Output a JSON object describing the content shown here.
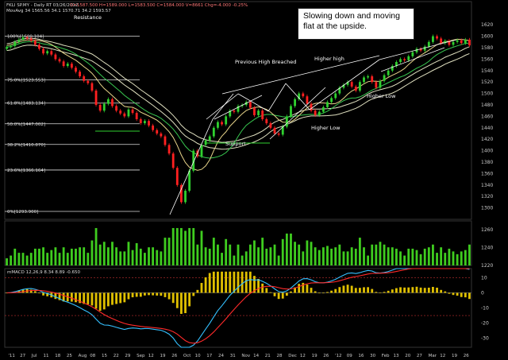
{
  "header": {
    "symbol_line": "FKLI SP.MY - Daily RT  03/26/2012",
    "ohlc_line": "O=1587.500  H=1589.000  L=1583.500  C=1584.000  V=8661  Chg=-4.000  -0.25%",
    "ma_line": "MovAvg 34  1565.56  34.1  1570.71  34.2  1593.57"
  },
  "note": "Slowing down and moving flat at the upside.",
  "annotations": {
    "resistance": "Resistance",
    "support": "Support",
    "previous_high": "Previous High Breached",
    "higher_high": "Higher high",
    "higher_low_1": "Higher Low",
    "higher_low_2": "Higher Low"
  },
  "macd_label": "mMACD 12,26,9  8.34  8.89  -0.650",
  "colors": {
    "background": "#000000",
    "up_candle": "#2fd12f",
    "down_candle": "#ff2020",
    "volume": "#3fcc1f",
    "macd_line": "#34c0ff",
    "signal_line": "#ff2a2a",
    "histogram": "#e0c000",
    "ma_fast": "#e8d48a",
    "ma_mid": "#38c850",
    "ma_slow": "#e0e0c0"
  },
  "chart_data": [
    {
      "type": "candlestick",
      "title": "FKLI SP.MY - Daily",
      "ylim": [
        1280,
        1630
      ],
      "y_ticks": [
        1300,
        1320,
        1340,
        1360,
        1380,
        1400,
        1420,
        1440,
        1460,
        1480,
        1500,
        1520,
        1540,
        1560,
        1580,
        1600,
        1620
      ],
      "fib_levels": [
        {
          "label": "100%[1600.104]",
          "value": 1600.104
        },
        {
          "label": "75.0%[1523.553]",
          "value": 1523.553
        },
        {
          "label": "61.8%[1483.134]",
          "value": 1483.134
        },
        {
          "label": "50.0%[1447.002]",
          "value": 1447.002
        },
        {
          "label": "38.2%[1410.870]",
          "value": 1410.87
        },
        {
          "label": "23.6%[1366.164]",
          "value": 1366.164
        },
        {
          "label": "0%[1293.900]",
          "value": 1293.9
        }
      ],
      "x_labels": [
        "'11",
        "27",
        "Jul",
        "11",
        "18",
        "25",
        "Aug",
        "08",
        "15",
        "22",
        "29",
        "Sep",
        "12",
        "19",
        "26",
        "Oct",
        "10",
        "17",
        "24",
        "31",
        "Nov",
        "14",
        "21",
        "28",
        "Dec",
        "12",
        "19",
        "26",
        "'12",
        "09",
        "16",
        "30",
        "Feb",
        "13",
        "20",
        "27",
        "Mar",
        "12",
        "19",
        "26"
      ],
      "closes": [
        1581,
        1583,
        1590,
        1594,
        1598,
        1596,
        1592,
        1585,
        1578,
        1570,
        1574,
        1568,
        1560,
        1556,
        1548,
        1552,
        1545,
        1538,
        1530,
        1522,
        1518,
        1505,
        1480,
        1470,
        1482,
        1490,
        1478,
        1470,
        1465,
        1460,
        1472,
        1466,
        1455,
        1448,
        1452,
        1444,
        1436,
        1430,
        1425,
        1410,
        1395,
        1370,
        1340,
        1310,
        1330,
        1365,
        1400,
        1390,
        1410,
        1418,
        1425,
        1440,
        1450,
        1446,
        1460,
        1470,
        1468,
        1478,
        1480,
        1485,
        1475,
        1462,
        1470,
        1455,
        1448,
        1440,
        1430,
        1428,
        1442,
        1460,
        1478,
        1490,
        1500,
        1495,
        1482,
        1470,
        1462,
        1468,
        1476,
        1485,
        1492,
        1500,
        1510,
        1515,
        1520,
        1512,
        1505,
        1520,
        1528,
        1530,
        1520,
        1510,
        1522,
        1532,
        1540,
        1548,
        1555,
        1560,
        1558,
        1565,
        1572,
        1578,
        1575,
        1582,
        1590,
        1600,
        1596,
        1588,
        1592,
        1585,
        1590,
        1593,
        1588,
        1594,
        1584
      ],
      "volume_ylim": [
        1220,
        1270
      ],
      "volume_ticks": [
        1220,
        1240,
        1260
      ],
      "macd": {
        "values_label": "mMACD 12,26,9",
        "ylim": [
          -36,
          16
        ],
        "ticks": [
          -30,
          -20,
          -10,
          0,
          10
        ]
      }
    }
  ]
}
